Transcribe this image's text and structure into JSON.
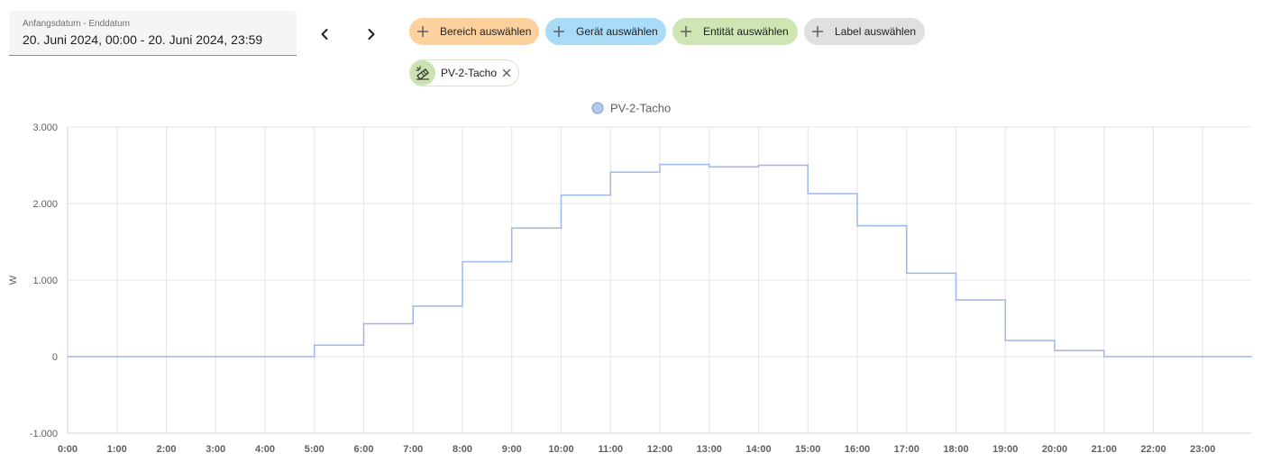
{
  "date_picker": {
    "label": "Anfangsdatum - Enddatum",
    "value": "20. Juni 2024, 00:00 - 20. Juni 2024, 23:59"
  },
  "nav": {
    "prev_icon": "chevron-left-icon",
    "next_icon": "chevron-right-icon"
  },
  "filters": [
    {
      "id": "area",
      "label": "Bereich auswählen",
      "color": "#fdd19e"
    },
    {
      "id": "device",
      "label": "Gerät auswählen",
      "color": "#a8dcf7"
    },
    {
      "id": "entity",
      "label": "Entität auswählen",
      "color": "#cde6b3"
    },
    {
      "id": "label",
      "label": "Label auswählen",
      "color": "#e0e0e0"
    }
  ],
  "selected_entity": {
    "label": "PV-2-Tacho",
    "icon": "solar-power-icon",
    "avatar_color": "#c9e2b0"
  },
  "chart_data": {
    "type": "line",
    "step": true,
    "legend": {
      "label": "PV-2-Tacho",
      "position": "top-center",
      "color": "#9db8e8"
    },
    "ylabel": "W",
    "ylim": [
      -1000,
      3000
    ],
    "yticks": [
      -1000,
      0,
      1000,
      2000,
      3000
    ],
    "ytick_labels": [
      "-1.000",
      "0",
      "1.000",
      "2.000",
      "3.000"
    ],
    "xlim": [
      0,
      24
    ],
    "xticks": [
      0,
      1,
      2,
      3,
      4,
      5,
      6,
      7,
      8,
      9,
      10,
      11,
      12,
      13,
      14,
      15,
      16,
      17,
      18,
      19,
      20,
      21,
      22,
      23
    ],
    "xtick_labels": [
      "0:00",
      "1:00",
      "2:00",
      "3:00",
      "4:00",
      "5:00",
      "6:00",
      "7:00",
      "8:00",
      "9:00",
      "10:00",
      "11:00",
      "12:00",
      "13:00",
      "14:00",
      "15:00",
      "16:00",
      "17:00",
      "18:00",
      "19:00",
      "20:00",
      "21:00",
      "22:00",
      "23:00"
    ],
    "grid": true,
    "series": [
      {
        "name": "PV-2-Tacho",
        "color": "#9db8e8",
        "x": [
          0,
          1,
          2,
          3,
          4,
          5,
          6,
          7,
          8,
          9,
          10,
          11,
          12,
          13,
          14,
          15,
          16,
          17,
          18,
          19,
          20,
          21,
          22,
          23,
          24
        ],
        "values": [
          0,
          0,
          0,
          0,
          0,
          150,
          430,
          660,
          1240,
          1680,
          2110,
          2410,
          2510,
          2480,
          2500,
          2130,
          1710,
          1090,
          740,
          210,
          80,
          0,
          0,
          0,
          0
        ]
      }
    ]
  }
}
